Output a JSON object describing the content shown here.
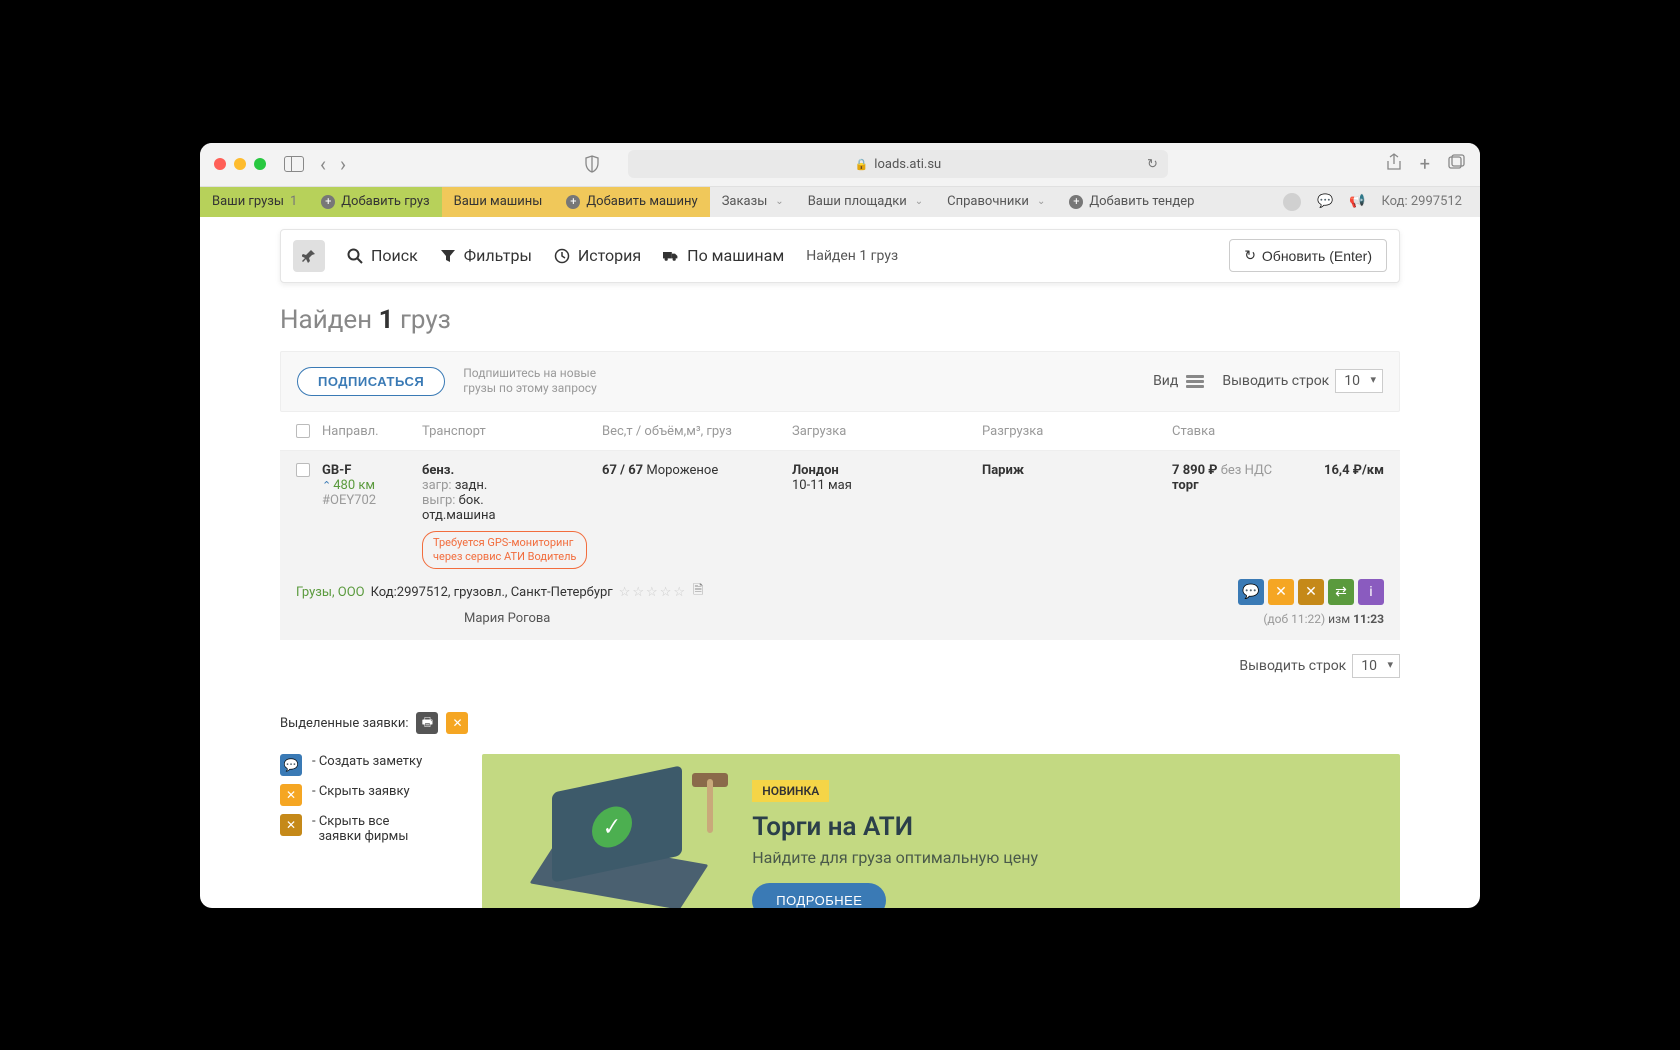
{
  "browser": {
    "url": "loads.ati.su"
  },
  "topnav": {
    "cargo_tab": "Ваши грузы",
    "cargo_count": "1",
    "add_cargo": "Добавить груз",
    "vehicles_tab": "Ваши машины",
    "add_vehicle": "Добавить машину",
    "orders": "Заказы",
    "platforms": "Ваши площадки",
    "refs": "Справочники",
    "add_tender": "Добавить тендер",
    "code_label": "Код:",
    "code_value": "2997512"
  },
  "filterbar": {
    "search": "Поиск",
    "filters": "Фильтры",
    "history": "История",
    "by_vehicles": "По машинам",
    "found": "Найден 1 груз",
    "refresh": "Обновить (Enter)"
  },
  "heading": {
    "prefix": "Найден ",
    "count": "1",
    "suffix": " груз"
  },
  "controls": {
    "subscribe": "ПОДПИСАТЬСЯ",
    "subscribe_hint1": "Подпишитесь на новые",
    "subscribe_hint2": "грузы по этому запросу",
    "view_label": "Вид",
    "rows_label": "Выводить строк",
    "rows_value": "10"
  },
  "columns": {
    "direction": "Направл.",
    "transport": "Транспорт",
    "weight": "Вес,т / объём,м³, груз",
    "loading": "Загрузка",
    "unloading": "Разгрузка",
    "rate": "Ставка"
  },
  "row": {
    "dir_code": "GB-F",
    "distance": "480 км",
    "order_id": "#OEY702",
    "tr_type": "бенз.",
    "tr_load_lbl": "загр: ",
    "tr_load_val": "задн.",
    "tr_unload_lbl": "выгр: ",
    "tr_unload_val": "бок.",
    "tr_dedicated": "отд.машина",
    "gps_line1": "Требуется GPS-мониторинг",
    "gps_line2": "через сервис АТИ Водитель",
    "weight": "67 / 67 ",
    "cargo_name": "Мороженое",
    "load_city": "Лондон",
    "load_date": "10-11 мая",
    "unload_city": "Париж",
    "price": "7 890 ₽ ",
    "nds": "без НДС",
    "torg": "торг",
    "per_km": "16,4 ₽/км",
    "firm": "Грузы, ООО",
    "meta": " Код:2997512, грузовл., Санкт-Петербург",
    "contact": "Мария Рогова",
    "added": "(доб 11:22)",
    "changed_lbl": " изм ",
    "changed_time": "11:23"
  },
  "bottom_rows": {
    "label": "Выводить строк",
    "value": "10"
  },
  "selected": {
    "label": "Выделенные заявки:"
  },
  "legend": {
    "note": "Создать заметку",
    "hide": "Скрыть заявку",
    "hide_all1": "Скрыть все",
    "hide_all2": "заявки фирмы"
  },
  "banner": {
    "tag": "НОВИНКА",
    "title": "Торги на АТИ",
    "subtitle": "Найдите для груза оптимальную цену",
    "more": "ПОДРОБНЕЕ"
  }
}
